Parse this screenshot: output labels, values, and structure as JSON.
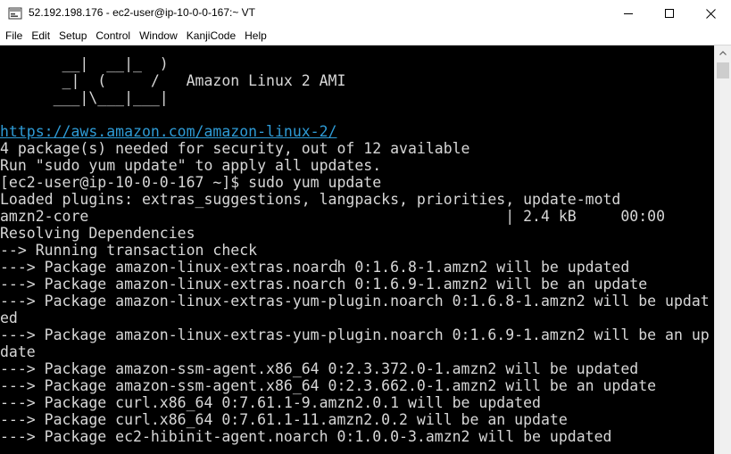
{
  "window": {
    "title": "52.192.198.176 - ec2-user@ip-10-0-0-167:~ VT"
  },
  "menu": {
    "items": [
      "File",
      "Edit",
      "Setup",
      "Control",
      "Window",
      "KanjiCode",
      "Help"
    ]
  },
  "terminal": {
    "lines": [
      "       __|  __|_  )",
      "       _|  (     /   Amazon Linux 2 AMI",
      "      ___|\\___|___|",
      "",
      "https://aws.amazon.com/amazon-linux-2/",
      "4 package(s) needed for security, out of 12 available",
      "Run \"sudo yum update\" to apply all updates.",
      "[ec2-user@ip-10-0-0-167 ~]$ sudo yum update",
      "Loaded plugins: extras_suggestions, langpacks, priorities, update-motd",
      "amzn2-core                                               | 2.4 kB     00:00",
      "Resolving Dependencies",
      "--> Running transaction check",
      "---> Package amazon-linux-extras.noarch 0:1.6.8-1.amzn2 will be updated",
      "---> Package amazon-linux-extras.noarch 0:1.6.9-1.amzn2 will be an update",
      "---> Package amazon-linux-extras-yum-plugin.noarch 0:1.6.8-1.amzn2 will be updat",
      "ed",
      "---> Package amazon-linux-extras-yum-plugin.noarch 0:1.6.9-1.amzn2 will be an up",
      "date",
      "---> Package amazon-ssm-agent.x86_64 0:2.3.372.0-1.amzn2 will be updated",
      "---> Package amazon-ssm-agent.x86_64 0:2.3.662.0-1.amzn2 will be an update",
      "---> Package curl.x86_64 0:7.61.1-9.amzn2.0.1 will be updated",
      "---> Package curl.x86_64 0:7.61.1-11.amzn2.0.2 will be an update",
      "---> Package ec2-hibinit-agent.noarch 0:1.0.0-3.amzn2 will be updated"
    ],
    "link_line_index": 4,
    "fg_color": "#d7d7d7",
    "bg_color": "#000000",
    "link_color": "#2e9bd6"
  }
}
